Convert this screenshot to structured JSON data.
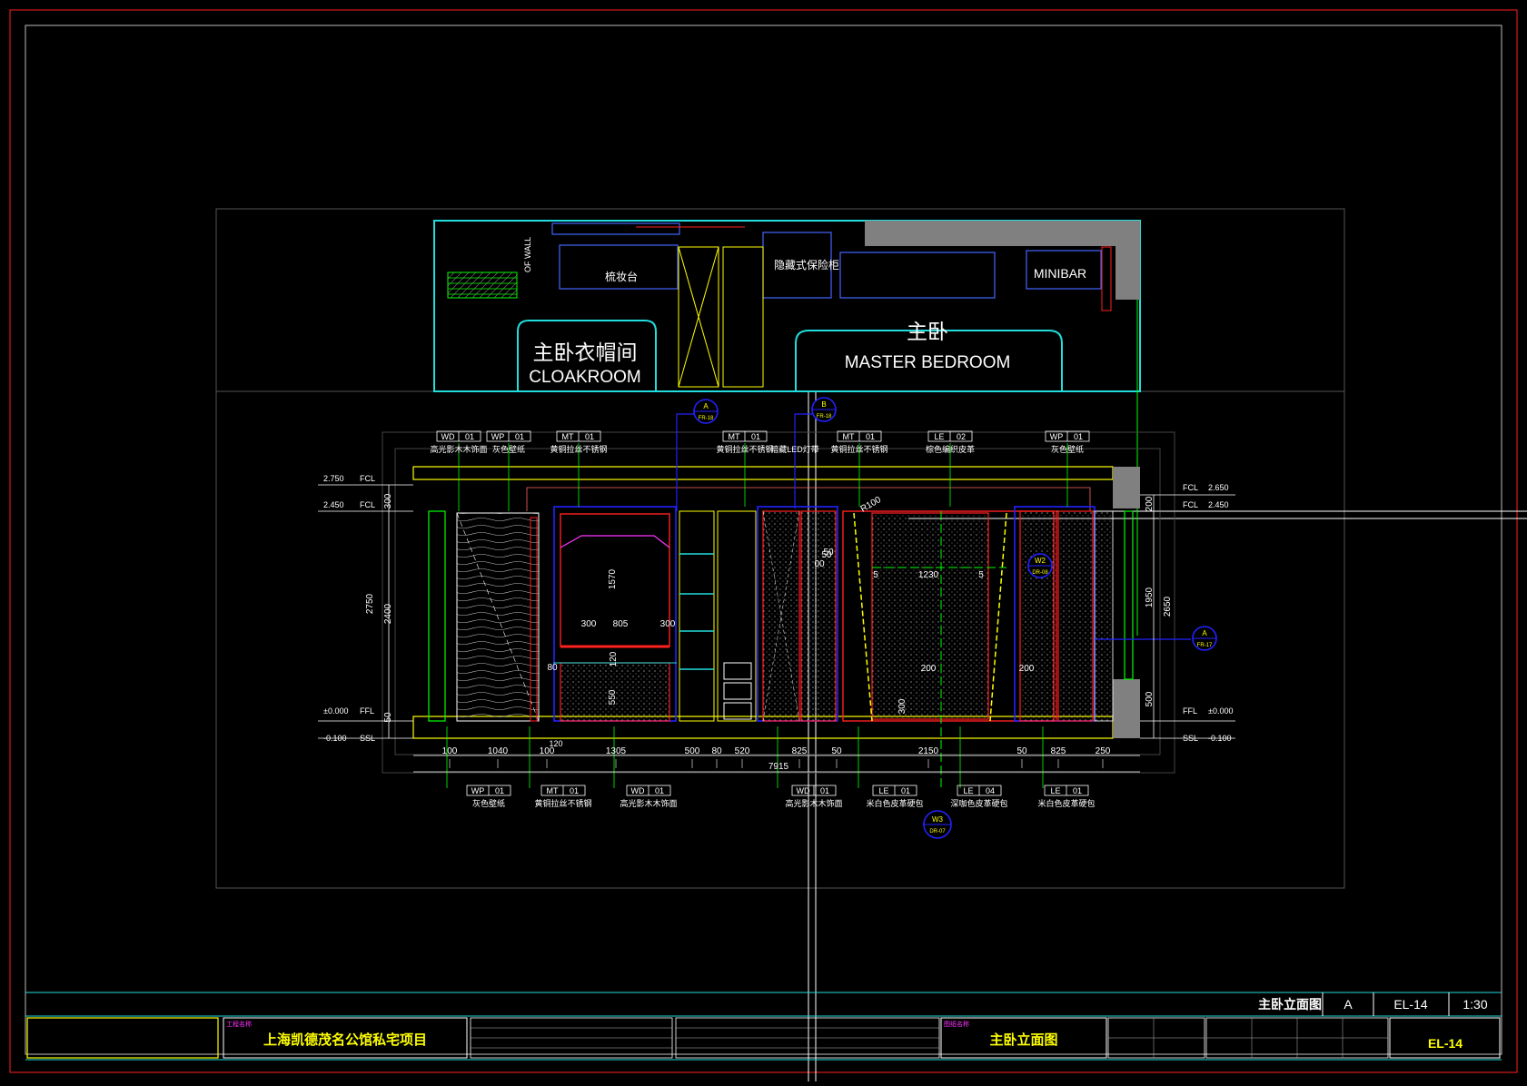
{
  "plan": {
    "cloakroom_cn": "主卧衣帽间",
    "cloakroom_en": "CLOAKROOM",
    "bedroom_cn": "主卧",
    "bedroom_en": "MASTER BEDROOM",
    "vanity": "梳妆台",
    "safe": "隐藏式保险柜",
    "minibar": "MINIBAR",
    "wall_label": "OF WALL"
  },
  "tags_top": [
    {
      "code": "WD",
      "num": "01",
      "desc": "高光影木木饰面"
    },
    {
      "code": "WP",
      "num": "01",
      "desc": "灰色壁纸"
    },
    {
      "code": "MT",
      "num": "01",
      "desc": "黄铜拉丝不锈钢"
    },
    {
      "code": "MT",
      "num": "01",
      "desc": "黄铜拉丝不锈钢"
    },
    {
      "code": "",
      "num": "",
      "desc": "暗藏LED灯带"
    },
    {
      "code": "MT",
      "num": "01",
      "desc": "黄铜拉丝不锈钢"
    },
    {
      "code": "LE",
      "num": "02",
      "desc": "棕色编织皮革"
    },
    {
      "code": "WP",
      "num": "01",
      "desc": "灰色壁纸"
    }
  ],
  "tags_bottom": [
    {
      "code": "WP",
      "num": "01",
      "desc": "灰色壁纸"
    },
    {
      "code": "MT",
      "num": "01",
      "desc": "黄铜拉丝不锈钢"
    },
    {
      "code": "WD",
      "num": "01",
      "desc": "高光影木木饰面"
    },
    {
      "code": "WD",
      "num": "01",
      "desc": "高光影木木饰面"
    },
    {
      "code": "LE",
      "num": "01",
      "desc": "米白色皮革硬包"
    },
    {
      "code": "LE",
      "num": "04",
      "desc": "深咖色皮革硬包"
    },
    {
      "code": "LE",
      "num": "01",
      "desc": "米白色皮革硬包"
    }
  ],
  "callouts": [
    {
      "top": "A",
      "bottom": "FR-18"
    },
    {
      "top": "B",
      "bottom": "FR-18"
    },
    {
      "top": "A",
      "bottom": "FR-17"
    },
    {
      "top": "W3",
      "bottom": "DR-07"
    },
    {
      "top": "W2",
      "bottom": "DR-08"
    }
  ],
  "levels_left": [
    {
      "value": "2.750",
      "tag": "FCL"
    },
    {
      "value": "2.450",
      "tag": "FCL"
    },
    {
      "value": "±0.000",
      "tag": "FFL"
    },
    {
      "value": "-0.100",
      "tag": "SSL"
    }
  ],
  "levels_right": [
    {
      "value": "2.650",
      "tag": "FCL"
    },
    {
      "value": "2.450",
      "tag": "FCL"
    },
    {
      "value": "±0.000",
      "tag": "FFL"
    },
    {
      "value": "-0.100",
      "tag": "SSL"
    }
  ],
  "dims_bottom": [
    "100",
    "1040",
    "100",
    "1305",
    "500",
    "80",
    "520",
    "825",
    "50",
    "2150",
    "50",
    "825",
    "250"
  ],
  "dim_120": "120",
  "dim_total": "7915",
  "dims_left": [
    "300",
    "2750",
    "2400",
    "50"
  ],
  "dims_right": [
    "200",
    "1950",
    "2650",
    "500"
  ],
  "dims_inner": [
    "1570",
    "300",
    "805",
    "300",
    "1230",
    "50",
    "200",
    "200",
    "300",
    "550",
    "120",
    "80",
    "R100",
    "5",
    "5",
    "00",
    "50"
  ],
  "title_bar": {
    "drawing_name": "主卧立面图",
    "section": "A",
    "sheet": "EL-14",
    "scale": "1:30"
  },
  "title_block": {
    "project_label": "工程名称",
    "project": "上海凯德茂名公馆私宅项目",
    "drawing_label": "图纸名称",
    "drawing": "主卧立面图",
    "sheet_no": "EL-14"
  },
  "colors": {
    "red": "#ff2020",
    "cyan": "#22dddd",
    "yellow": "#ffff00",
    "green": "#00ff00",
    "blue": "#2222ff",
    "magenta": "#ff33ff",
    "white": "#ffffff",
    "grey": "#808080"
  }
}
